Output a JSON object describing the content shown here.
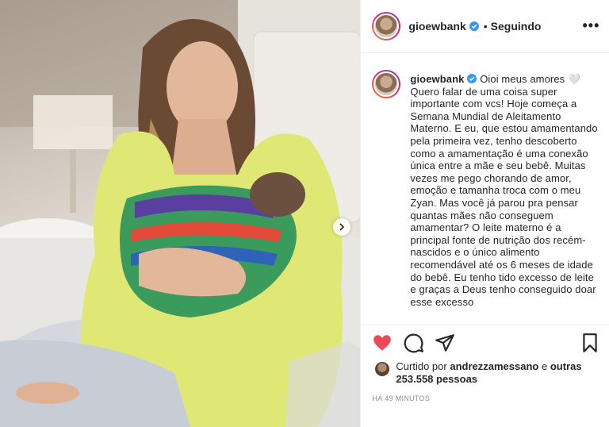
{
  "header": {
    "username": "gioewbank",
    "separator": "•",
    "follow_status": "Seguindo",
    "more": "•••"
  },
  "caption": {
    "username": "gioewbank",
    "text": "Oioi meus amores 🤍 Quero falar de uma coisa super importante com vcs! Hoje começa a Semana Mundial de Aleitamento Materno. E eu, que estou amamentando pela primeira vez, tenho descoberto como a amamentação é uma conexão única entre a mãe e seu bebê. Muitas vezes me pego chorando de amor, emoção e tamanha troca com o meu Zyan. Mas você já parou pra pensar quantas mães não conseguem amamentar? O leite materno é a principal fonte de nutrição dos recém-nascidos e o único alimento recomendável até os 6 meses de idade do bebê. Eu tenho tido excesso de leite e graças a Deus tenho conseguido doar esse excesso"
  },
  "likes": {
    "prefix": "Curtido por",
    "user": "andrezzamessano",
    "joiner": "e",
    "others": "outras 253.558 pessoas"
  },
  "timestamp": "HÁ 49 MINUTOS",
  "colors": {
    "like_red": "#ed4956",
    "verified_blue": "#3897f0",
    "text": "#262626",
    "muted": "#8e8e8e"
  },
  "icons": [
    "heart-icon",
    "comment-icon",
    "share-icon",
    "bookmark-icon",
    "verified-icon",
    "chevron-right-icon",
    "more-icon"
  ]
}
